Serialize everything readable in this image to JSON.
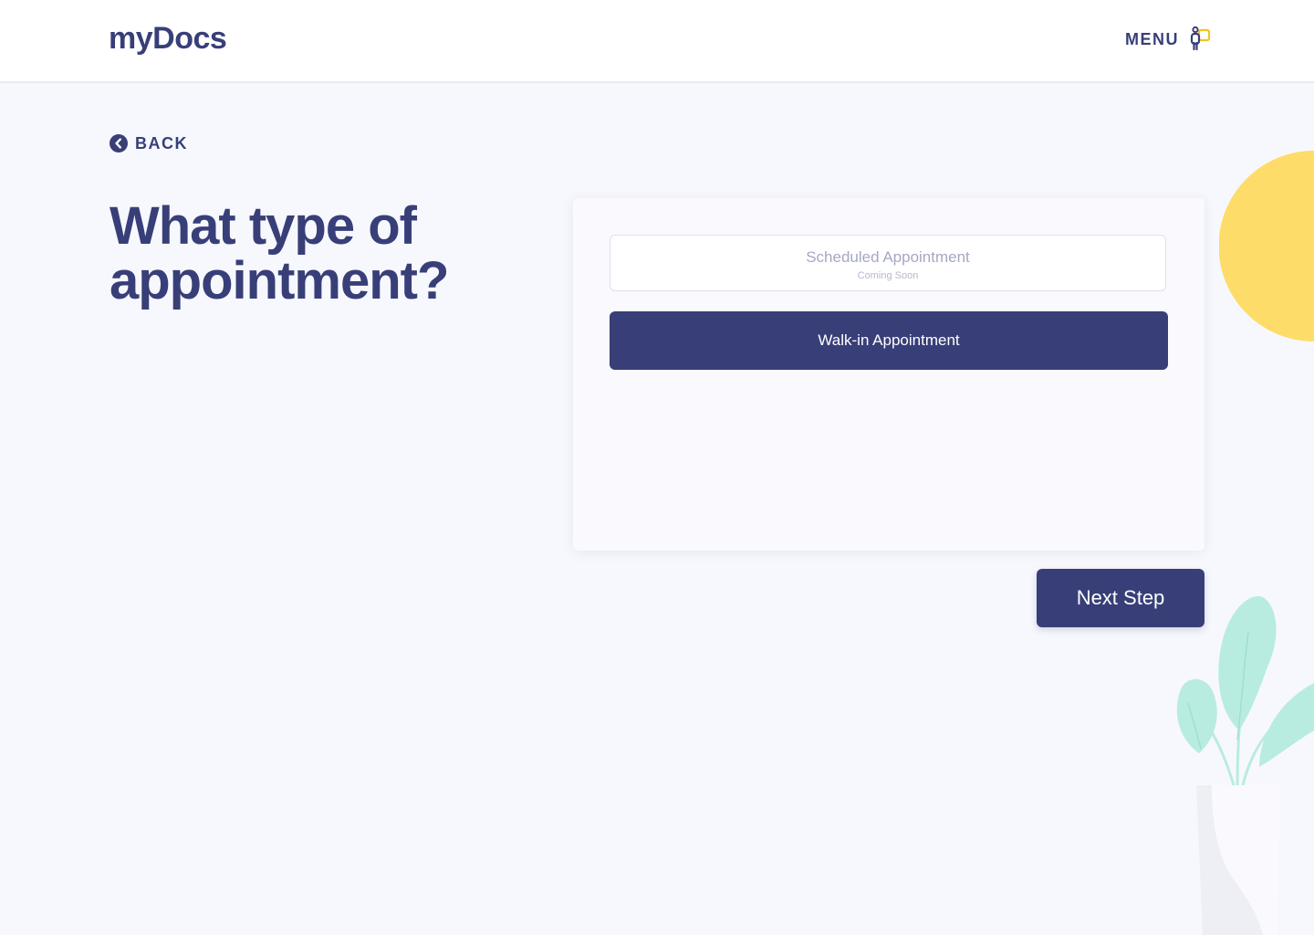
{
  "header": {
    "logo": "myDocs",
    "menu_label": "MENU",
    "menu_icon": "person-menu-icon"
  },
  "nav": {
    "back_label": "BACK",
    "back_icon": "chevron-left-circle-icon"
  },
  "main": {
    "title": "What type of appointment?",
    "options": [
      {
        "label": "Scheduled Appointment",
        "sublabel": "Coming Soon",
        "state": "disabled"
      },
      {
        "label": "Walk-in Appointment",
        "state": "selected"
      }
    ],
    "next_label": "Next Step"
  },
  "colors": {
    "primary": "#383f78",
    "background": "#f7f8fd",
    "accent_yellow": "#fedc69",
    "plant_green": "#b9ece0",
    "disabled_text": "#a5a8c2"
  }
}
